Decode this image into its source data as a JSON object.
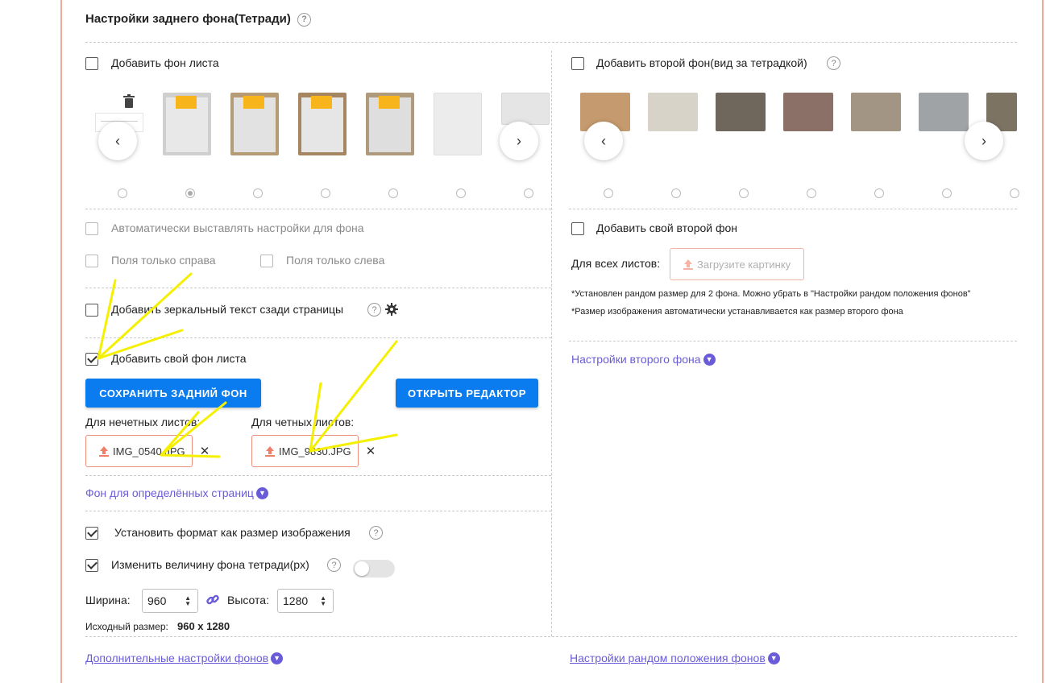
{
  "section": {
    "title": "Настройки заднего фона(Тетради)",
    "help_glyph": "?"
  },
  "left": {
    "add_sheet_bg": {
      "label": "Добавить фон листа",
      "checked": false
    },
    "carousel": {
      "prev": "‹",
      "next": "›",
      "trash_icon": "trash-icon",
      "selected_index": 1
    },
    "auto_settings": {
      "label": "Автоматически выставлять настройки для фона",
      "checked": false
    },
    "margins_right": {
      "label": "Поля только справа",
      "checked": false
    },
    "margins_left": {
      "label": "Поля только слева",
      "checked": false
    },
    "mirror_text": {
      "label": "Добавить зеркальный текст сзади страницы",
      "checked": false
    },
    "own_bg": {
      "label": "Добавить свой фон листа",
      "checked": true
    },
    "save_button": "СОХРАНИТЬ ЗАДНИЙ ФОН",
    "editor_button": "ОТКРЫТЬ РЕДАКТОР",
    "odd_label": "Для нечетных листов:",
    "even_label": "Для четных листов:",
    "odd_file": "IMG_0540.JPG",
    "even_file": "IMG_9830.JPG",
    "remove_glyph": "✕",
    "specific_pages_link": "Фон для определённых страниц",
    "format_as_image": {
      "label": "Установить формат как размер изображения",
      "checked": true
    },
    "resize_bg": {
      "label": "Изменить величину фона тетради(px)",
      "checked": true,
      "toggle_on": false
    },
    "width_label": "Ширина:",
    "width_value": "960",
    "height_label": "Высота:",
    "height_value": "1280",
    "original_size_label": "Исходный размер:",
    "original_size_value": "960 x 1280",
    "extra_settings_link": "Дополнительные настройки фонов"
  },
  "right": {
    "second_bg": {
      "label": "Добавить второй фон(вид за тетрадкой)",
      "checked": false
    },
    "carousel": {
      "prev": "‹",
      "next": "›"
    },
    "own_second_bg": {
      "label": "Добавить свой второй фон",
      "checked": false
    },
    "all_sheets_label": "Для всех листов:",
    "upload_button": "Загрузите картинку",
    "note1": "*Установлен рандом размер для 2 фона. Можно убрать в \"Настройки рандом положения фонов\"",
    "note2": "*Размер изображения автоматически устанавливается как размер второго фона",
    "second_settings_link": "Настройки второго фона",
    "random_position_link": "Настройки рандом положения фонов"
  },
  "colors": {
    "accent_blue": "#0a7cf0",
    "link_purple": "#6a5cd8",
    "upload_border": "#ef8f7d",
    "highlight_yellow": "#f5f000"
  }
}
